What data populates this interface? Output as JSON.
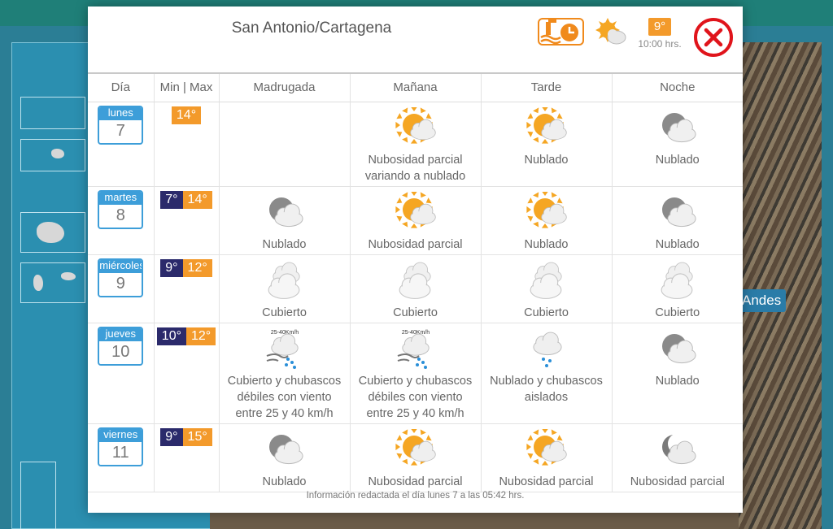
{
  "background": {
    "label": "Andes"
  },
  "header": {
    "station": "San Antonio/Cartagena",
    "current_temp": "9°",
    "current_time": "10:00 hrs."
  },
  "table": {
    "columns": [
      "Día",
      "Min | Max",
      "Madrugada",
      "Mañana",
      "Tarde",
      "Noche"
    ],
    "rows": [
      {
        "day": "lunes",
        "num": "7",
        "min": "",
        "max": "14°",
        "periods": [
          {
            "icon": "",
            "desc": ""
          },
          {
            "icon": "partly-cloudy-icon",
            "desc": "Nubosidad parcial variando a nublado"
          },
          {
            "icon": "partly-cloudy-icon",
            "desc": "Nublado"
          },
          {
            "icon": "cloudy-night-icon",
            "desc": "Nublado"
          }
        ]
      },
      {
        "day": "martes",
        "num": "8",
        "min": "7°",
        "max": "14°",
        "periods": [
          {
            "icon": "cloudy-night-icon",
            "desc": "Nublado"
          },
          {
            "icon": "partly-cloudy-icon",
            "desc": "Nubosidad parcial"
          },
          {
            "icon": "partly-cloudy-icon",
            "desc": "Nublado"
          },
          {
            "icon": "cloudy-night-icon",
            "desc": "Nublado"
          }
        ]
      },
      {
        "day": "miércoles",
        "num": "9",
        "min": "9°",
        "max": "12°",
        "periods": [
          {
            "icon": "overcast-icon",
            "desc": "Cubierto"
          },
          {
            "icon": "overcast-icon",
            "desc": "Cubierto"
          },
          {
            "icon": "overcast-icon",
            "desc": "Cubierto"
          },
          {
            "icon": "overcast-icon",
            "desc": "Cubierto"
          }
        ]
      },
      {
        "day": "jueves",
        "num": "10",
        "min": "10°",
        "max": "12°",
        "periods": [
          {
            "icon": "wind-showers-icon",
            "wind": "25-40Km/h",
            "desc": "Cubierto y chubascos débiles con viento entre 25 y 40 km/h"
          },
          {
            "icon": "wind-showers-icon",
            "wind": "25-40Km/h",
            "desc": "Cubierto y chubascos débiles con viento entre 25 y 40 km/h"
          },
          {
            "icon": "cloud-showers-icon",
            "desc": "Nublado y chubascos aislados"
          },
          {
            "icon": "cloudy-night-icon",
            "desc": "Nublado"
          }
        ]
      },
      {
        "day": "viernes",
        "num": "11",
        "min": "9°",
        "max": "15°",
        "periods": [
          {
            "icon": "cloudy-night-icon",
            "desc": "Nublado"
          },
          {
            "icon": "partly-cloudy-icon",
            "desc": "Nubosidad parcial"
          },
          {
            "icon": "partly-cloudy-icon",
            "desc": "Nubosidad parcial"
          },
          {
            "icon": "moon-cloud-icon",
            "desc": "Nubosidad parcial"
          }
        ]
      }
    ]
  },
  "footer": {
    "note": "Información redactada el día lunes 7 a las 05:42 hrs."
  },
  "colors": {
    "accent_blue": "#3d9ed9",
    "min_temp": "#2b2a6b",
    "max_temp": "#f39a2b",
    "close_red": "#e0141b"
  }
}
